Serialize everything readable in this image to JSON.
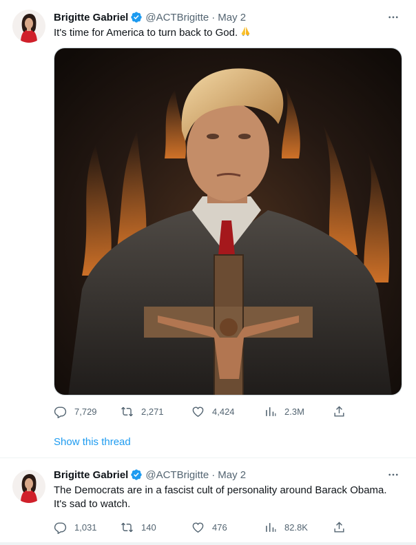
{
  "tweets": [
    {
      "author_name": "Brigitte Gabriel",
      "handle": "@ACTBrigitte",
      "separator": "·",
      "date": "May 2",
      "text": "It's time for America to turn back to God.",
      "text_emoji": "folded-hands-emoji",
      "media_description_icon": "ai-portrait-image",
      "stats": {
        "replies": "7,729",
        "retweets": "2,271",
        "likes": "4,424",
        "views": "2.3M"
      },
      "show_thread": "Show this thread"
    },
    {
      "author_name": "Brigitte Gabriel",
      "handle": "@ACTBrigitte",
      "separator": "·",
      "date": "May 2",
      "text_line1": "The Democrats are in a fascist cult of personality around Barack Obama.",
      "text_line2": "It's sad to watch.",
      "stats": {
        "replies": "1,031",
        "retweets": "140",
        "likes": "476",
        "views": "82.8K"
      }
    }
  ],
  "colors": {
    "accent": "#1d9bf0",
    "muted": "#536471",
    "text": "#0f1419",
    "border": "#eff3f4"
  }
}
